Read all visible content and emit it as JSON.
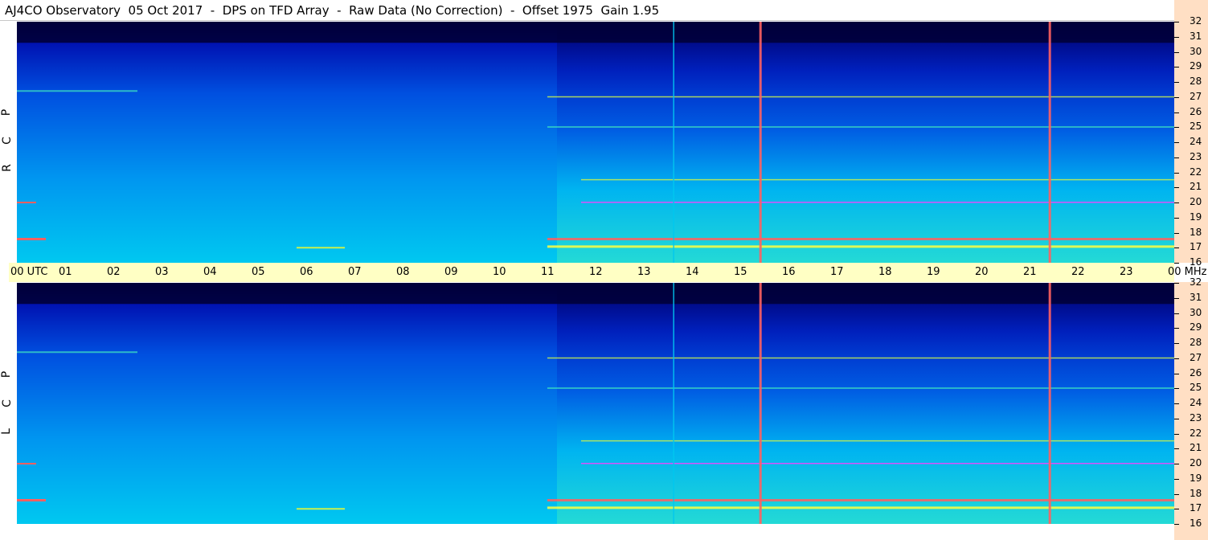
{
  "title": "AJ4CO Observatory  05 Oct 2017  -  DPS on TFD Array  -  Raw Data (No Correction)  -  Offset 1975  Gain 1.95",
  "panels": [
    {
      "id": "rcp",
      "polarization_letters": [
        "R",
        "C",
        "P"
      ]
    },
    {
      "id": "lcp",
      "polarization_letters": [
        "L",
        "C",
        "P"
      ]
    }
  ],
  "time_axis": {
    "labels": [
      "00 UTC",
      "01",
      "02",
      "03",
      "04",
      "05",
      "06",
      "07",
      "08",
      "09",
      "10",
      "11",
      "12",
      "13",
      "14",
      "15",
      "16",
      "17",
      "18",
      "19",
      "20",
      "21",
      "22",
      "23",
      "00 MHz"
    ]
  },
  "chart_data": {
    "type": "heatmap",
    "title": "AJ4CO Observatory  05 Oct 2017  -  DPS on TFD Array  -  Raw Data (No Correction)  -  Offset 1975  Gain 1.95",
    "x_unit": "UTC",
    "y_unit": "MHz",
    "x_range": [
      0,
      24
    ],
    "y_range": [
      16,
      32
    ],
    "y_ticks": [
      16,
      17,
      18,
      19,
      20,
      21,
      22,
      23,
      24,
      25,
      26,
      27,
      28,
      29,
      30,
      31,
      32
    ],
    "x_ticks": [
      "00",
      "01",
      "02",
      "03",
      "04",
      "05",
      "06",
      "07",
      "08",
      "09",
      "10",
      "11",
      "12",
      "13",
      "14",
      "15",
      "16",
      "17",
      "18",
      "19",
      "20",
      "21",
      "22",
      "23",
      "00"
    ],
    "colormap": [
      "#00003a",
      "#0010b0",
      "#0050e0",
      "#0096f0",
      "#00c8f0",
      "#40e8c0",
      "#c8f050",
      "#ffff40",
      "#ff6060",
      "#ff40ff"
    ],
    "vertical_artifacts_utc": [
      13.62,
      15.42,
      21.42
    ],
    "horizontal_interference_mhz": [
      17.1,
      17.6,
      20.0,
      21.5,
      25.0,
      27.0
    ],
    "series": [
      {
        "name": "R C P",
        "panel": "rcp"
      },
      {
        "name": "L C P",
        "panel": "lcp"
      }
    ]
  },
  "colors": {
    "side_background": "#ffdfc4",
    "timebar_background": "#ffffc4",
    "frame": "#ffffff"
  }
}
